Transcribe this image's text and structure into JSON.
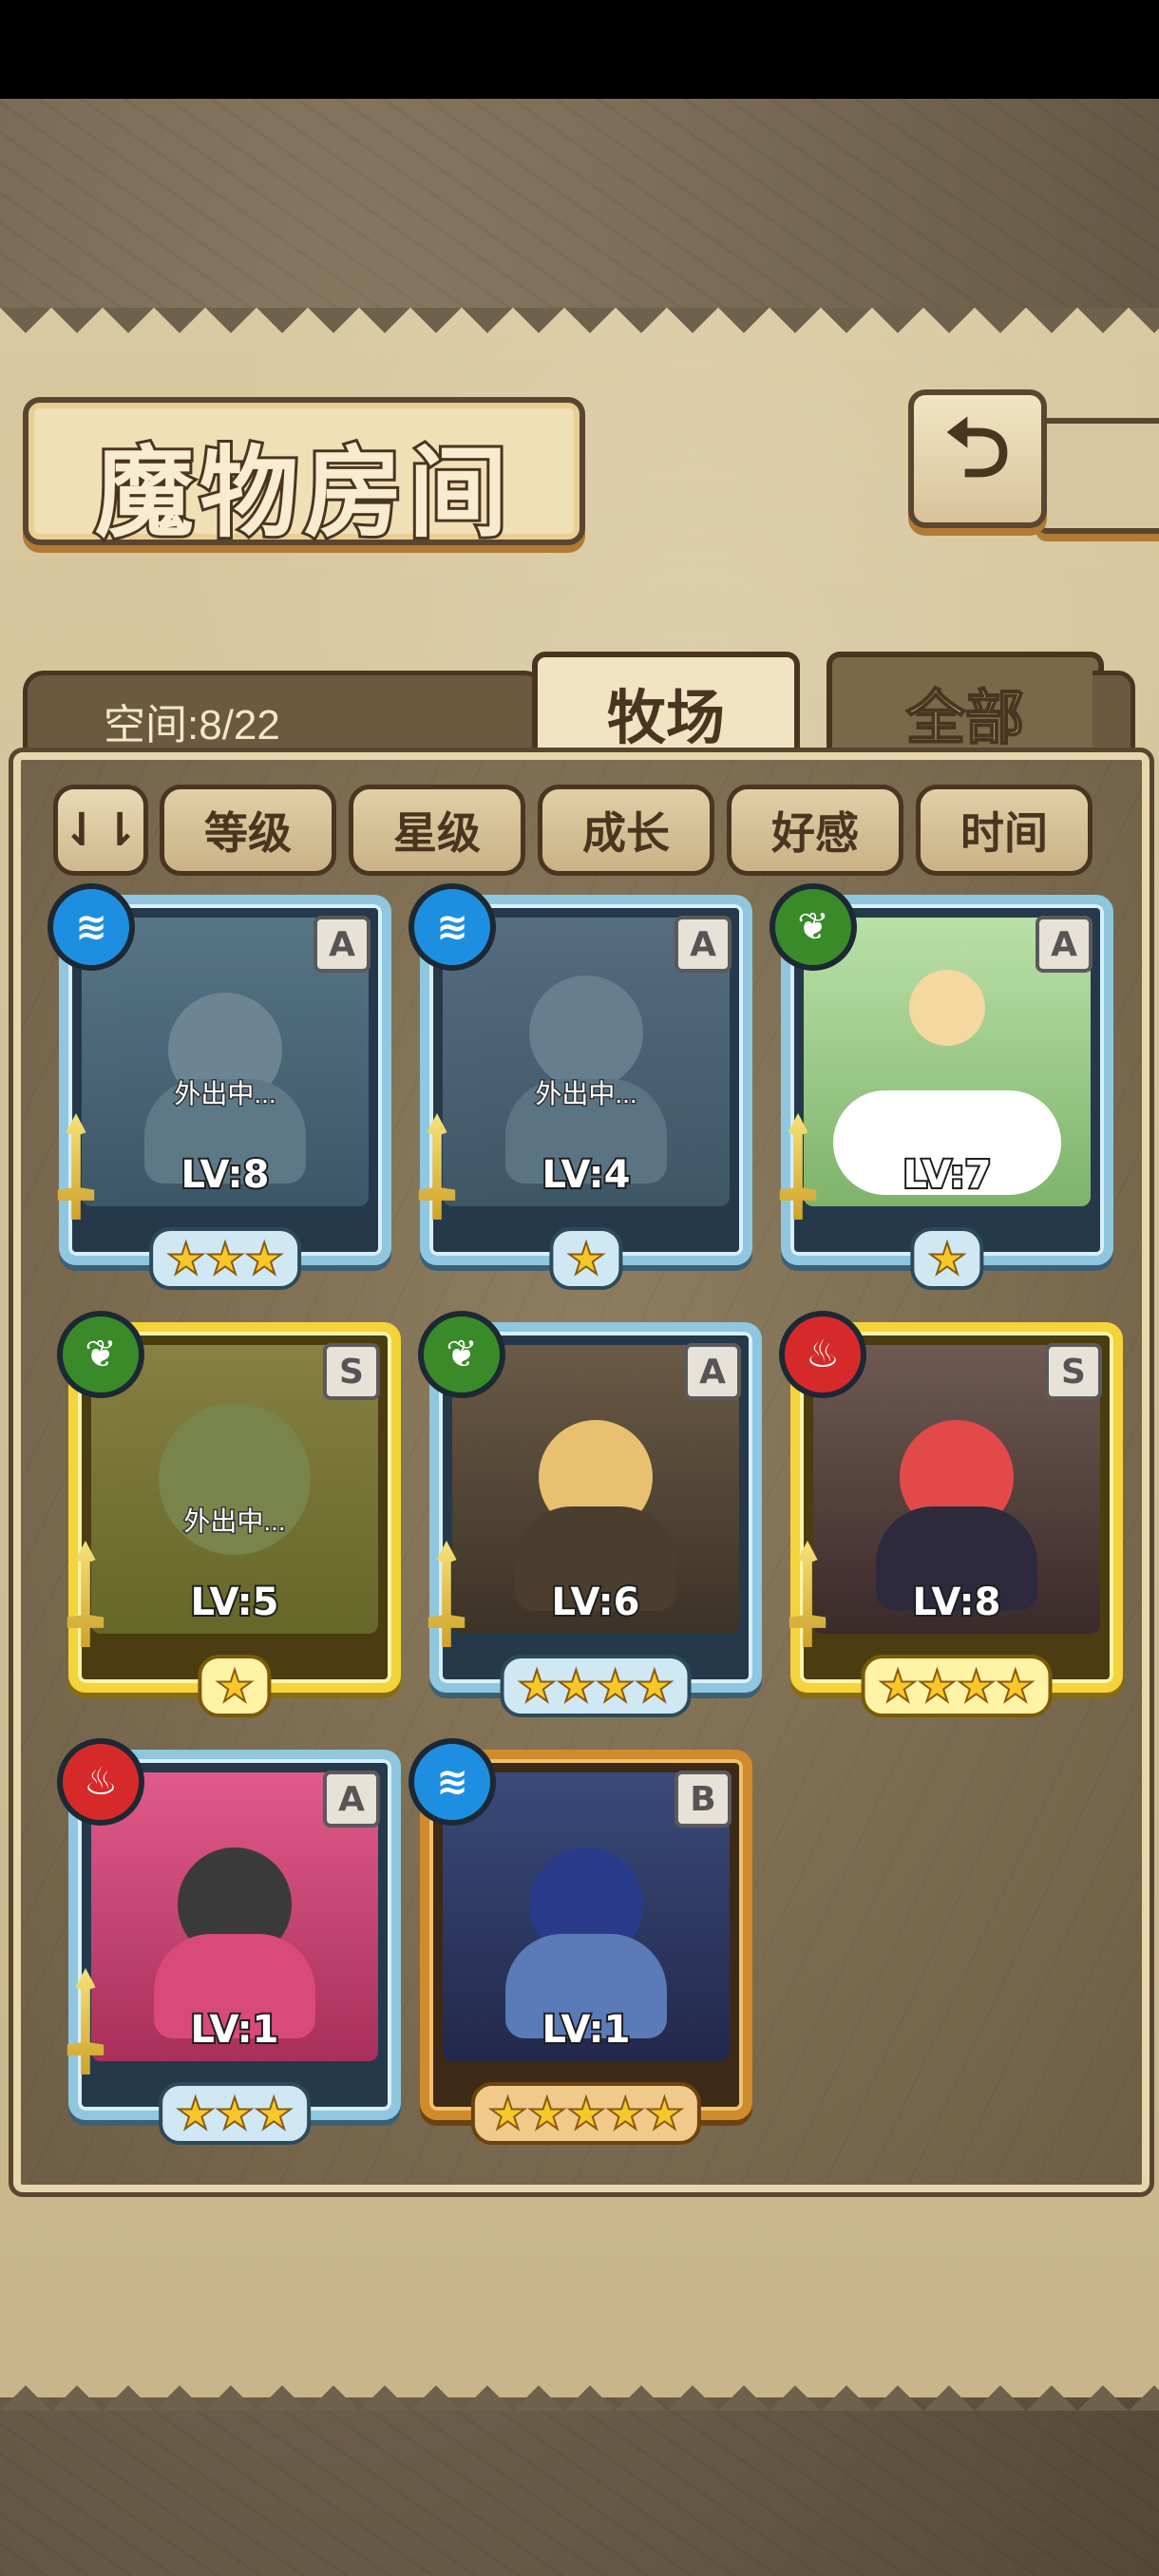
{
  "header": {
    "title": "魔物房间",
    "back_icon": "back-arrow-icon"
  },
  "tabs": {
    "space_label": "空间:8/22",
    "active": "牧场",
    "inactive": "全部"
  },
  "sort": {
    "toggle_icon": "sort-order-icon",
    "toggle_glyph": "⇃⇂",
    "buttons": [
      "等级",
      "星级",
      "成长",
      "好感",
      "时间"
    ]
  },
  "monsters": [
    {
      "element": "water",
      "element_glyph": "≋",
      "rank": "A",
      "level": "LV:8",
      "stars": "★★★",
      "status": "外出中...",
      "frame": "blue"
    },
    {
      "element": "water",
      "element_glyph": "≋",
      "rank": "A",
      "level": "LV:4",
      "stars": "★",
      "status": "外出中...",
      "frame": "blue"
    },
    {
      "element": "grass",
      "element_glyph": "❦",
      "rank": "A",
      "level": "LV:7",
      "stars": "★",
      "status": "",
      "frame": "blue"
    },
    {
      "element": "grass",
      "element_glyph": "❦",
      "rank": "S",
      "level": "LV:5",
      "stars": "★",
      "status": "外出中...",
      "frame": "gold"
    },
    {
      "element": "grass",
      "element_glyph": "❦",
      "rank": "A",
      "level": "LV:6",
      "stars": "★★★★",
      "status": "",
      "frame": "blue"
    },
    {
      "element": "fire",
      "element_glyph": "♨",
      "rank": "S",
      "level": "LV:8",
      "stars": "★★★★",
      "status": "",
      "frame": "gold"
    },
    {
      "element": "fire",
      "element_glyph": "♨",
      "rank": "A",
      "level": "LV:1",
      "stars": "★★★",
      "status": "",
      "frame": "blue"
    },
    {
      "element": "water",
      "element_glyph": "≋",
      "rank": "B",
      "level": "LV:1",
      "stars": "★★★★★",
      "status": "",
      "frame": "bronze"
    }
  ],
  "colors": {
    "water": "#1e8fe0",
    "grass": "#3a8a2a",
    "fire": "#d62a2a",
    "frame_blue": "#8ec7df",
    "frame_gold": "#f4d43a",
    "frame_bronze": "#d08b2d"
  }
}
